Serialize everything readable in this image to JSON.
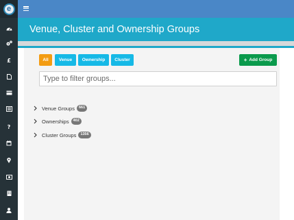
{
  "app": {
    "logo_letter": "e"
  },
  "sidebar": {
    "items": [
      {
        "name": "dashboard-icon"
      },
      {
        "name": "gears-icon"
      },
      {
        "name": "pound-icon",
        "glyph": "£"
      },
      {
        "name": "document-icon"
      },
      {
        "name": "card-icon"
      },
      {
        "name": "sitemap-icon"
      },
      {
        "name": "help-icon",
        "glyph": "?"
      },
      {
        "name": "calendar-icon"
      },
      {
        "name": "map-marker-icon"
      },
      {
        "name": "money-icon"
      },
      {
        "name": "building-icon"
      },
      {
        "name": "user-icon"
      }
    ]
  },
  "header": {
    "title": "Venue, Cluster and Ownership Groups"
  },
  "filters": {
    "all": "All",
    "venue": "Venue",
    "ownership": "Ownership",
    "cluster": "Cluster"
  },
  "actions": {
    "add_group": "Add Group"
  },
  "search": {
    "placeholder": "Type to filter groups..."
  },
  "groups": [
    {
      "label": "Venue Groups",
      "count": "661"
    },
    {
      "label": "Ownerships",
      "count": "402"
    },
    {
      "label": "Cluster Groups",
      "count": "1356"
    }
  ],
  "colors": {
    "sidebar": "#263238",
    "topbar": "#4a87c7",
    "header": "#1fa8c9",
    "filter_all": "#f39c12",
    "filter_other": "#16b9e6",
    "add_button": "#0a9a4c",
    "badge": "#777777"
  }
}
